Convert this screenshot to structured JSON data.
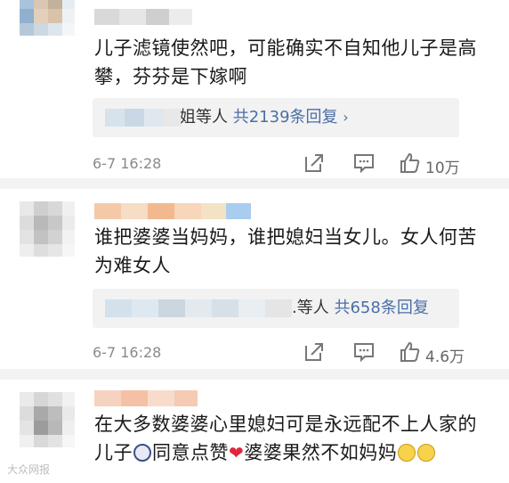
{
  "comments": [
    {
      "text": "儿子滤镜使然吧，可能确实不自知他儿子是高攀，芬芬是下嫁啊",
      "replies": {
        "suffix": "姐等人",
        "count_label": "共2139条回复",
        "chevron": "›"
      },
      "time": "6-7 16:28",
      "likes": "10万"
    },
    {
      "text": "谁把婆婆当妈妈，谁把媳妇当女儿。女人何苦为难女人",
      "replies": {
        "suffix": ".等人",
        "count_label": "共658条回复",
        "chevron": ""
      },
      "time": "6-7 16:28",
      "likes": "4.6万"
    },
    {
      "text_part1": "在大多数婆婆心里媳妇可是永远配不上人家的儿子",
      "text_part2": "同意点赞",
      "text_part3": "婆婆果然不如妈妈",
      "emoji": [
        "crying-face-emoji",
        "red-heart-emoji",
        "pleading-face-emoji"
      ]
    }
  ],
  "watermark": "大众网报",
  "colors": {
    "reply_link": "#4a6fa5",
    "heart": "#e0263c",
    "meta": "#8a8a8a"
  }
}
